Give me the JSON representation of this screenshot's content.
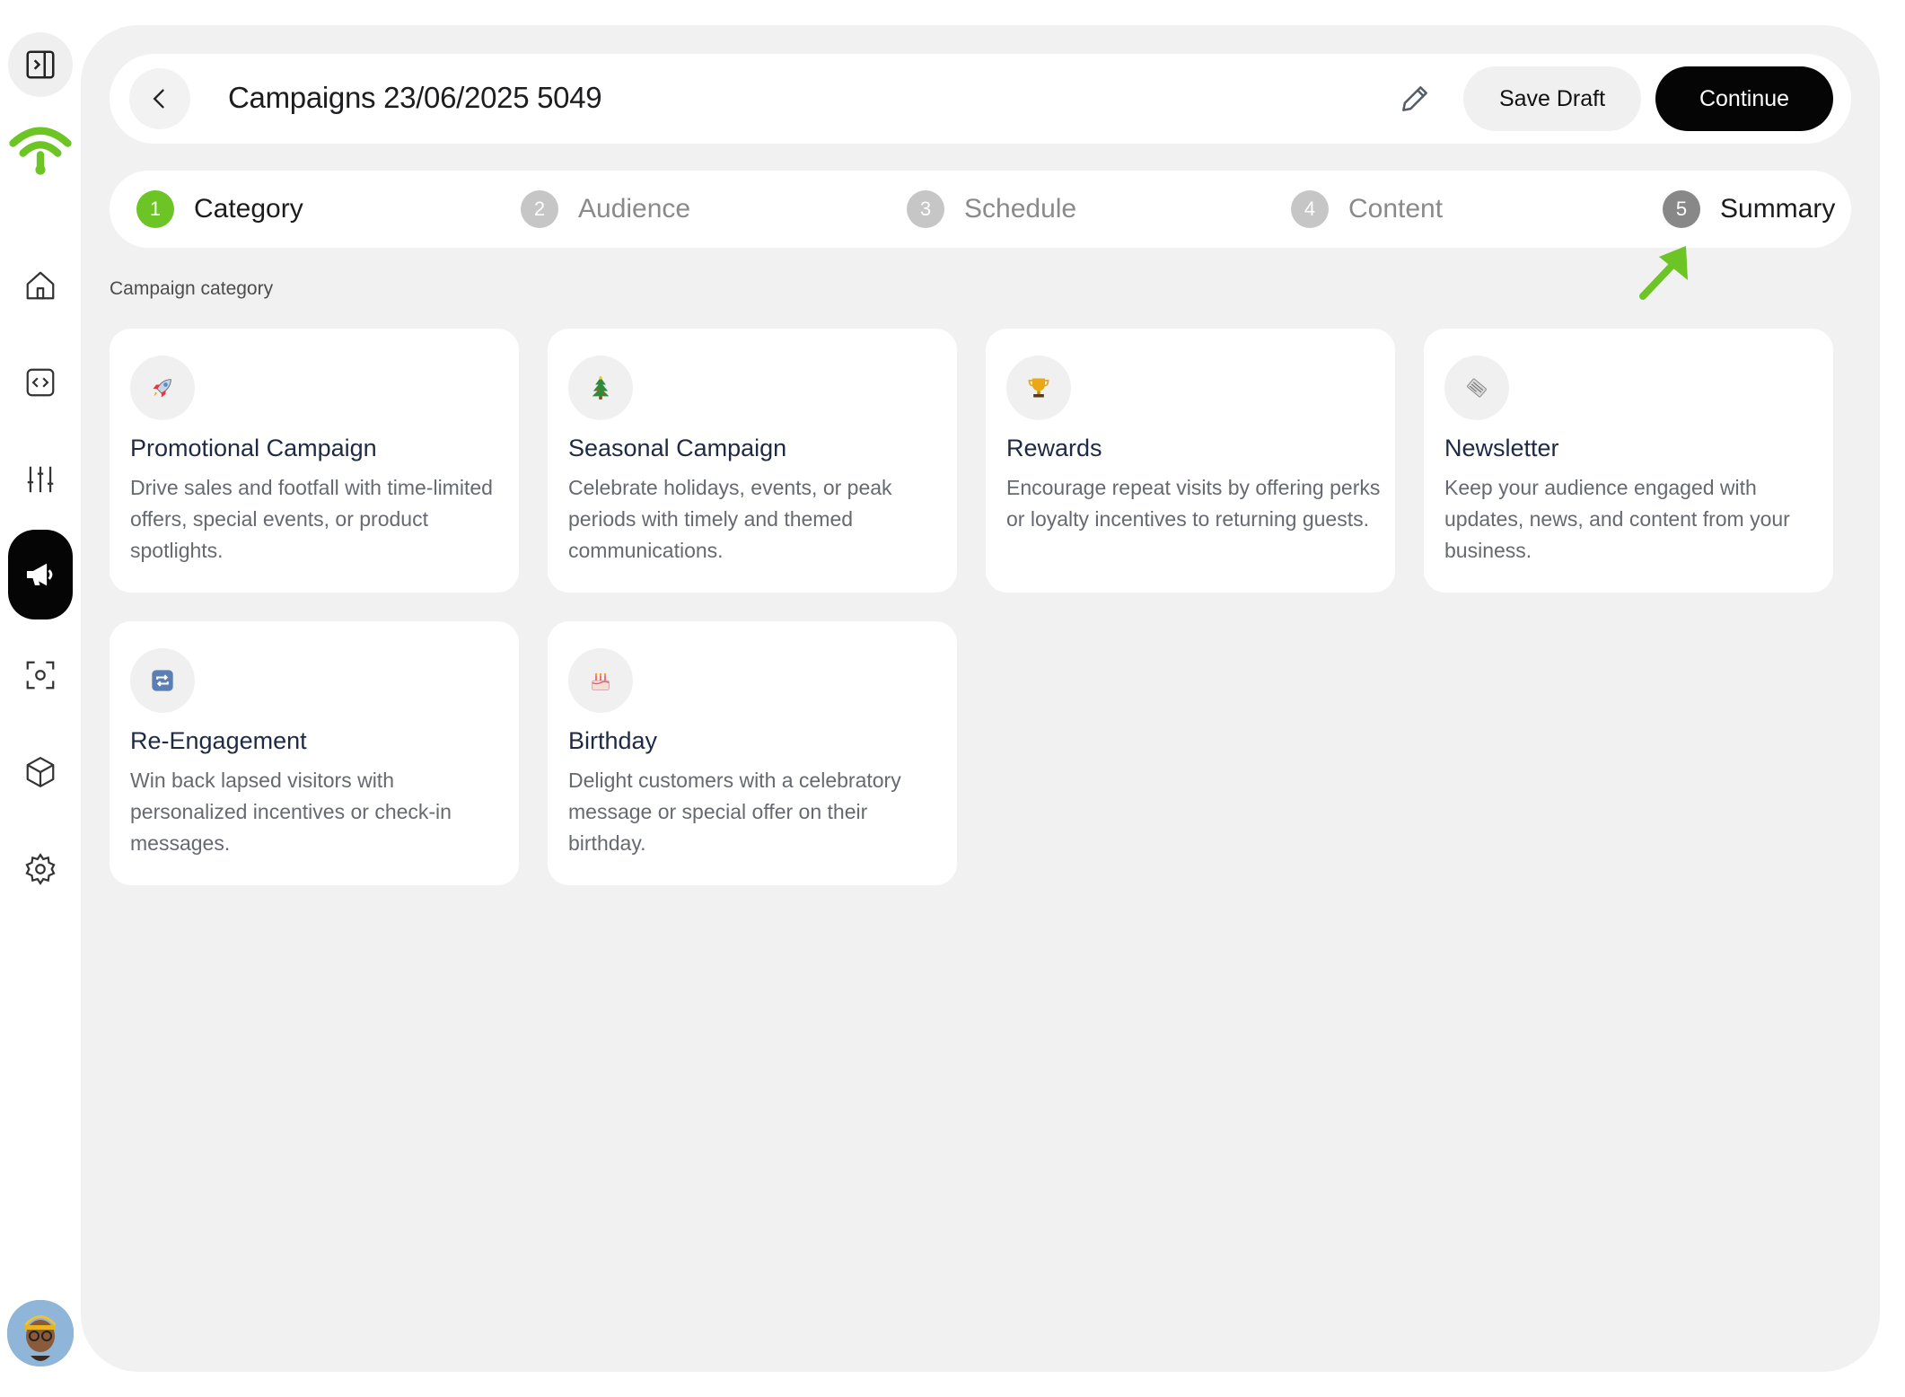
{
  "sidebar": {
    "items": [
      {
        "name": "panel-toggle-icon"
      },
      {
        "name": "wifi-logo-icon"
      },
      {
        "name": "home-icon"
      },
      {
        "name": "code-icon"
      },
      {
        "name": "sliders-icon"
      },
      {
        "name": "megaphone-icon",
        "active": true
      },
      {
        "name": "scan-face-icon"
      },
      {
        "name": "cube-icon"
      },
      {
        "name": "gear-icon"
      }
    ],
    "brand_color": "#6cc425"
  },
  "header": {
    "title": "Campaigns 23/06/2025 5049",
    "save_label": "Save Draft",
    "continue_label": "Continue"
  },
  "steps": [
    {
      "num": "1",
      "label": "Category",
      "state": "active"
    },
    {
      "num": "2",
      "label": "Audience",
      "state": "inactive"
    },
    {
      "num": "3",
      "label": "Schedule",
      "state": "inactive"
    },
    {
      "num": "4",
      "label": "Content",
      "state": "inactive"
    },
    {
      "num": "5",
      "label": "Summary",
      "state": "highlighted"
    }
  ],
  "section": {
    "label": "Campaign category"
  },
  "categories": [
    {
      "icon": "rocket-icon",
      "title": "Promotional Campaign",
      "desc": "Drive sales and footfall with time-limited offers, special events, or product spotlights."
    },
    {
      "icon": "tree-icon",
      "title": "Seasonal Campaign",
      "desc": "Celebrate holidays, events, or peak periods with timely and themed communications."
    },
    {
      "icon": "trophy-icon",
      "title": "Rewards",
      "desc": "Encourage repeat visits by offering perks or loyalty incentives to returning guests."
    },
    {
      "icon": "newspaper-icon",
      "title": "Newsletter",
      "desc": "Keep your audience engaged with updates, news, and content from your business."
    },
    {
      "icon": "repeat-icon",
      "title": "Re-Engagement",
      "desc": "Win back lapsed visitors with personalized incentives or check-in messages."
    },
    {
      "icon": "cake-icon",
      "title": "Birthday",
      "desc": "Delight customers with a celebratory message or special offer on their birthday."
    }
  ],
  "colors": {
    "accent_green": "#6cc425",
    "primary_button": "#050505",
    "background": "#f1f1f1"
  }
}
